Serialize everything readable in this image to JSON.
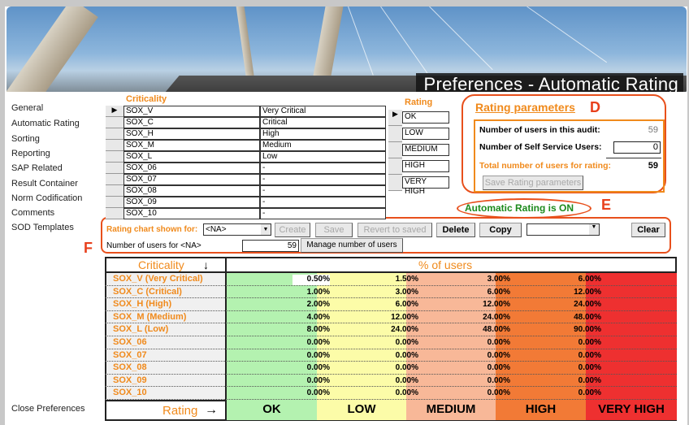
{
  "header": {
    "title": "Preferences - Automatic Rating"
  },
  "sidebar": {
    "items": [
      "General",
      "Automatic Rating",
      "Sorting",
      "Reporting",
      "SAP Related",
      "Result Container",
      "Norm Codification",
      "Comments",
      "SOD Templates"
    ],
    "close": "Close Preferences"
  },
  "criticality": {
    "label": "Criticality",
    "rows": [
      [
        "SOX_V",
        "Very Critical"
      ],
      [
        "SOX_C",
        "Critical"
      ],
      [
        "SOX_H",
        "High"
      ],
      [
        "SOX_M",
        "Medium"
      ],
      [
        "SOX_L",
        "Low"
      ],
      [
        "SOX_06",
        "-"
      ],
      [
        "SOX_07",
        "-"
      ],
      [
        "SOX_08",
        "-"
      ],
      [
        "SOX_09",
        "-"
      ],
      [
        "SOX_10",
        "-"
      ]
    ]
  },
  "rating": {
    "label": "Rating",
    "rows": [
      "OK",
      "LOW",
      "MEDIUM",
      "HIGH",
      "VERY HIGH"
    ]
  },
  "rating_parameters": {
    "title": "Rating parameters",
    "annotation": "D",
    "users_in_audit_label": "Number of users in this audit:",
    "users_in_audit": "59",
    "self_service_label": "Number of Self Service Users:",
    "self_service": "0",
    "total_label": "Total number of users for rating:",
    "total": "59",
    "save_button": "Save Rating parameters"
  },
  "status": {
    "text": "Automatic Rating is ON",
    "annotation": "E"
  },
  "chart_controls": {
    "annotation": "F",
    "shown_for_label": "Rating chart shown for:",
    "shown_for": "<NA>",
    "create": "Create",
    "save": "Save",
    "revert": "Revert to saved",
    "delete": "Delete",
    "copy": "Copy",
    "copy_target": "",
    "clear": "Clear",
    "users_for_label": "Number of users for <NA>",
    "users_for": "59",
    "manage": "Manage number of users"
  },
  "matrix": {
    "col_header": "Criticality",
    "arrow_down": "↓",
    "pct_header": "% of users",
    "rating_label": "Rating",
    "arrow_right": "→",
    "bands": [
      "OK",
      "LOW",
      "MEDIUM",
      "HIGH",
      "VERY HIGH"
    ],
    "band_colors": [
      "#b4f2b0",
      "#fcfca8",
      "#f8b898",
      "#f27a36",
      "#ee3030"
    ],
    "rows": [
      {
        "label": "SOX_V (Very Critical)",
        "values": [
          "0.50%",
          "1.50%",
          "3.00%",
          "6.00%"
        ]
      },
      {
        "label": "SOX_C (Critical)",
        "values": [
          "1.00%",
          "3.00%",
          "6.00%",
          "12.00%"
        ]
      },
      {
        "label": "SOX_H (High)",
        "values": [
          "2.00%",
          "6.00%",
          "12.00%",
          "24.00%"
        ]
      },
      {
        "label": "SOX_M (Medium)",
        "values": [
          "4.00%",
          "12.00%",
          "24.00%",
          "48.00%"
        ]
      },
      {
        "label": "SOX_L (Low)",
        "values": [
          "8.00%",
          "24.00%",
          "48.00%",
          "90.00%"
        ]
      },
      {
        "label": "SOX_06",
        "values": [
          "0.00%",
          "0.00%",
          "0.00%",
          "0.00%"
        ]
      },
      {
        "label": "SOX_07",
        "values": [
          "0.00%",
          "0.00%",
          "0.00%",
          "0.00%"
        ]
      },
      {
        "label": "SOX_08",
        "values": [
          "0.00%",
          "0.00%",
          "0.00%",
          "0.00%"
        ]
      },
      {
        "label": "SOX_09",
        "values": [
          "0.00%",
          "0.00%",
          "0.00%",
          "0.00%"
        ]
      },
      {
        "label": "SOX_10",
        "values": [
          "0.00%",
          "0.00%",
          "0.00%",
          "0.00%"
        ]
      }
    ]
  }
}
